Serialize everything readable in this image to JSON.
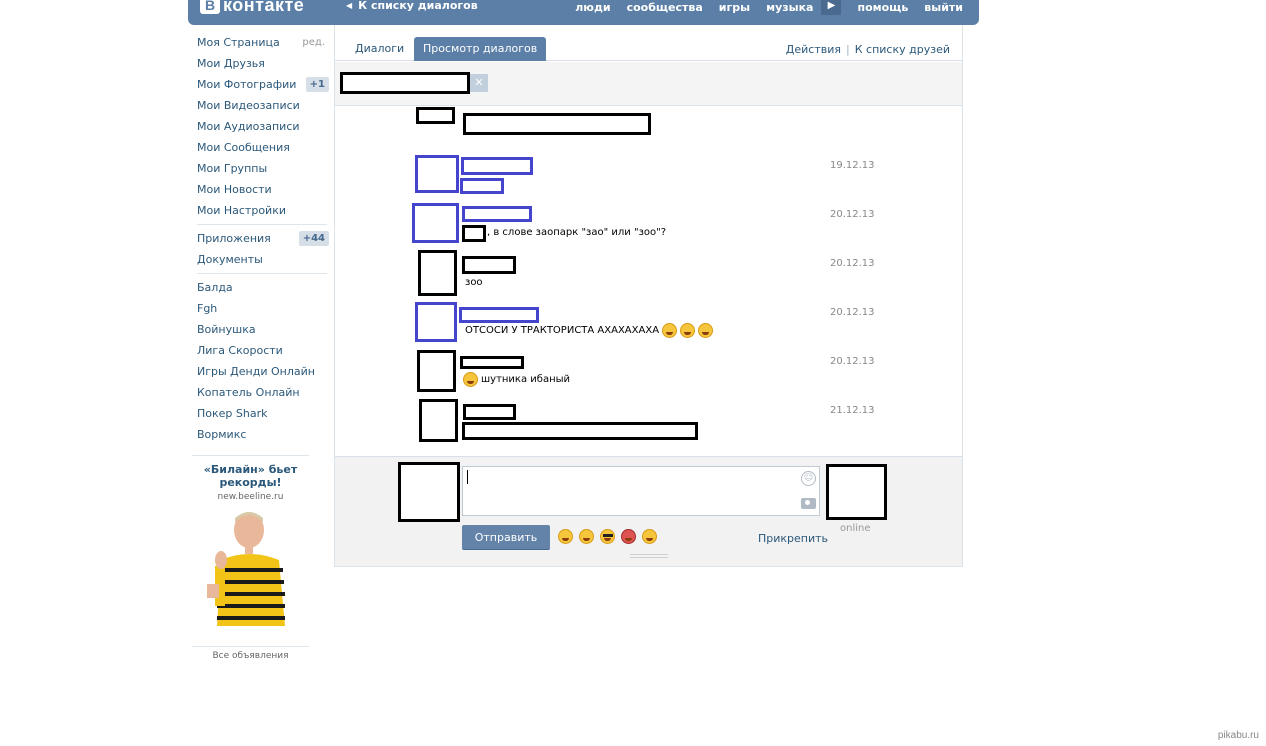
{
  "header": {
    "logo_letter": "В",
    "logo_text": "контакте",
    "back_label": "К списку диалогов",
    "nav": [
      "люди",
      "сообщества",
      "игры",
      "музыка",
      "помощь",
      "выйти"
    ]
  },
  "sidebar": {
    "items": [
      {
        "label": "Моя Страница",
        "extra": "ред."
      },
      {
        "label": "Мои Друзья"
      },
      {
        "label": "Мои Фотографии",
        "badge": "+1"
      },
      {
        "label": "Мои Видеозаписи"
      },
      {
        "label": "Мои Аудиозаписи"
      },
      {
        "label": "Мои Сообщения"
      },
      {
        "label": "Мои Группы"
      },
      {
        "label": "Мои Новости"
      },
      {
        "label": "Мои Настройки"
      }
    ],
    "apps": [
      {
        "label": "Приложения",
        "badge": "+44"
      },
      {
        "label": "Документы"
      }
    ],
    "games": [
      "Балда",
      "Fgh",
      "Войнушка",
      "Лига Скорости",
      "Игры Денди Онлайн",
      "Копатель Онлайн",
      "Покер Shark",
      "Вормикс"
    ]
  },
  "ad": {
    "title": "«Билайн» бьет рекорды!",
    "url": "new.beeline.ru",
    "footer": "Все объявления"
  },
  "tabs": {
    "dialogs": "Диалоги",
    "view": "Просмотр диалогов",
    "actions": "Действия",
    "friends": "К списку друзей"
  },
  "messages": [
    {
      "date": "19.12.13",
      "text": ""
    },
    {
      "date": "20.12.13",
      "text": ", в слове заопарк \"зао\" или \"зоо\"?"
    },
    {
      "date": "20.12.13",
      "text": "зоо"
    },
    {
      "date": "20.12.13",
      "text": "ОТСОСИ У ТРАКТОРИСТА АХАХАХАХА"
    },
    {
      "date": "20.12.13",
      "text": "шутника ибаный"
    },
    {
      "date": "21.12.13",
      "text": ""
    }
  ],
  "composer": {
    "send": "Отправить",
    "attach": "Прикрепить",
    "status": "online"
  },
  "watermark": "pikabu.ru",
  "colors": {
    "header": "#5b7fa6",
    "link": "#2b587a",
    "redact_blue": "#4444cc"
  }
}
